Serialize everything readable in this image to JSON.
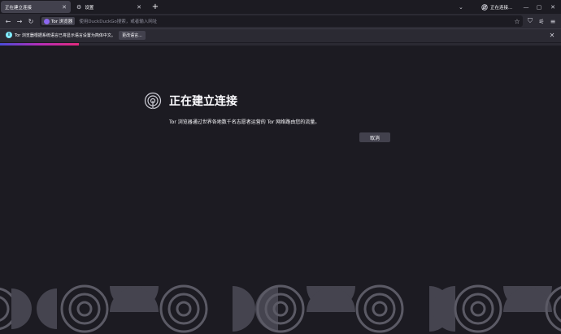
{
  "tabs": [
    {
      "label": "正在建立连接",
      "active": true
    },
    {
      "label": "设置",
      "icon": "gear-icon",
      "active": false
    }
  ],
  "proxy_tab": {
    "label": "正在连接...",
    "icon": "onion-icon"
  },
  "urlbar": {
    "badge": "Tor 浏览器",
    "placeholder": "使用DuckDuckGo搜索，或者输入网址"
  },
  "notification": {
    "text": "Tor 浏览器根据系统语言已将显示语言设置为简体中文。",
    "button": "更改语言..."
  },
  "progress": {
    "fraction": 0.14
  },
  "main": {
    "heading": "正在建立连接",
    "description": "Tor 浏览器通过世界各地数千名志愿者运营的 Tor 网络路由您的流量。",
    "cancel": "取消"
  },
  "colors": {
    "background": "#1c1b22",
    "toolbar": "#2b2a33",
    "button": "#42414d",
    "info_icon": "#80ebff",
    "tor_purple": "#8d67f0",
    "pattern": "#5b5a65"
  }
}
